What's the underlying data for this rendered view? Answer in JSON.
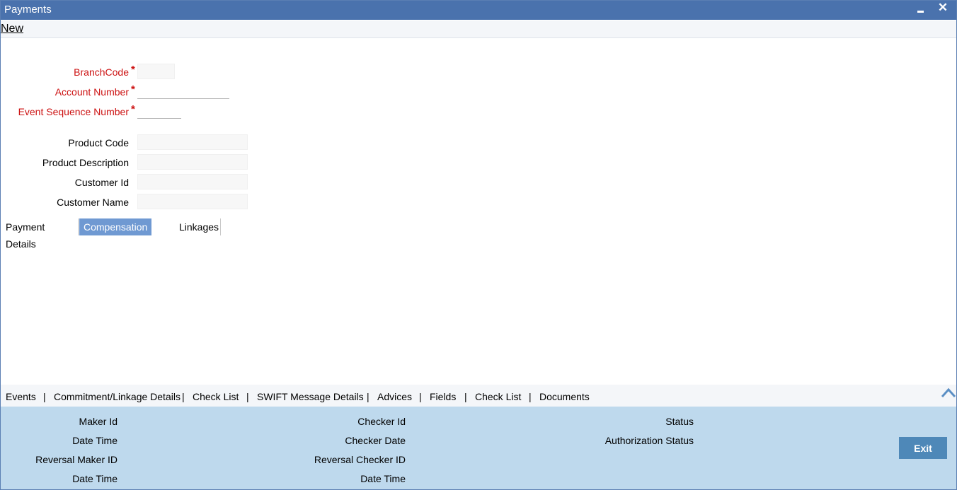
{
  "window": {
    "title": "Payments"
  },
  "menu": {
    "new_label": "New"
  },
  "form": {
    "branch_code": {
      "label": "BranchCode",
      "value": ""
    },
    "account_number": {
      "label": "Account Number",
      "value": ""
    },
    "event_seq": {
      "label": "Event Sequence Number",
      "value": ""
    },
    "product_code": {
      "label": "Product Code",
      "value": ""
    },
    "product_description": {
      "label": "Product Description",
      "value": ""
    },
    "customer_id": {
      "label": "Customer Id",
      "value": ""
    },
    "customer_name": {
      "label": "Customer Name",
      "value": ""
    },
    "required_marker": "*"
  },
  "tabs": [
    {
      "label": "Payment Details",
      "active": false
    },
    {
      "label": "Compensation Rates",
      "active": true
    },
    {
      "label": "Linkages",
      "active": false
    }
  ],
  "bottom_nav": {
    "items": [
      "Events",
      "Commitment/Linkage Details",
      "Check List",
      "SWIFT Message Details",
      "Advices",
      "Fields",
      "Check List",
      "Documents"
    ],
    "separator": "|"
  },
  "audit": {
    "maker_id": "Maker Id",
    "date_time_1": "Date Time",
    "reversal_maker_id": "Reversal Maker ID",
    "date_time_2": "Date Time",
    "checker_id": "Checker Id",
    "checker_date": "Checker Date",
    "reversal_checker_id": "Reversal Checker ID",
    "date_time_3": "Date Time",
    "status": "Status",
    "authorization_status": "Authorization Status"
  },
  "buttons": {
    "exit": "Exit"
  },
  "colors": {
    "titlebar": "#4a72ad",
    "active_tab": "#6f99d2",
    "audit_bg": "#bed9ed",
    "required": "#cc1111"
  }
}
